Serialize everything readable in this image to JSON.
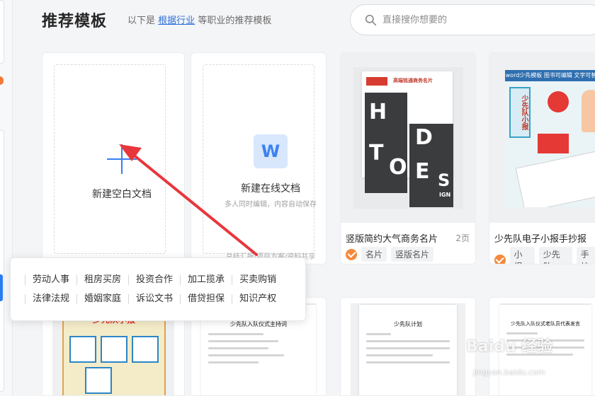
{
  "header": {
    "title": "推荐模板",
    "subtitle_prefix": "以下是",
    "subtitle_link": "根据行业",
    "subtitle_suffix": "等职业的推荐模板"
  },
  "search": {
    "placeholder": "直接搜你想要的",
    "icon": "search-icon"
  },
  "cards": {
    "new_blank": {
      "label": "新建空白文档"
    },
    "new_online": {
      "label": "新建在线文档",
      "desc": "多人同时编辑，内容自动保存",
      "foot": "总结汇报/项目方案/资料共享",
      "icon_letter": "W"
    },
    "business_card": {
      "name": "竖版简约大气商务名片",
      "pages": "2页",
      "tags": [
        "名片",
        "竖版名片"
      ],
      "thumb_header": "高端铭通商务名片",
      "thumb_letters": [
        "H",
        "T",
        "O",
        "D",
        "E",
        "S"
      ],
      "thumb_sign": "IGN"
    },
    "poster": {
      "name": "少先队电子小报手抄报",
      "tags": [
        "小报",
        "少先队",
        "手抄"
      ],
      "thumb_band": "word少先模板 图书可编辑 文字可替换",
      "thumb_col": "少先队小报"
    }
  },
  "popup": {
    "row1": [
      "劳动人事",
      "租房买房",
      "投资合作",
      "加工揽承",
      "买卖购销"
    ],
    "row2": [
      "法律法规",
      "婚姻家庭",
      "诉讼文书",
      "借贷担保",
      "知识产权"
    ]
  },
  "bottom": {
    "poster_title": "少先队小报",
    "doc1_title": "少先队入队仪式主持词",
    "doc2_title": "少先队计划",
    "doc3_title": "少先队入队仪式老队员代表发言"
  },
  "watermark": {
    "brand": "Baidu 经验",
    "url": "jingyan.baidu.com"
  },
  "colors": {
    "accent": "#3a7ef0",
    "arrow": "#e8373c",
    "tag_icon": "#f58a3c"
  }
}
